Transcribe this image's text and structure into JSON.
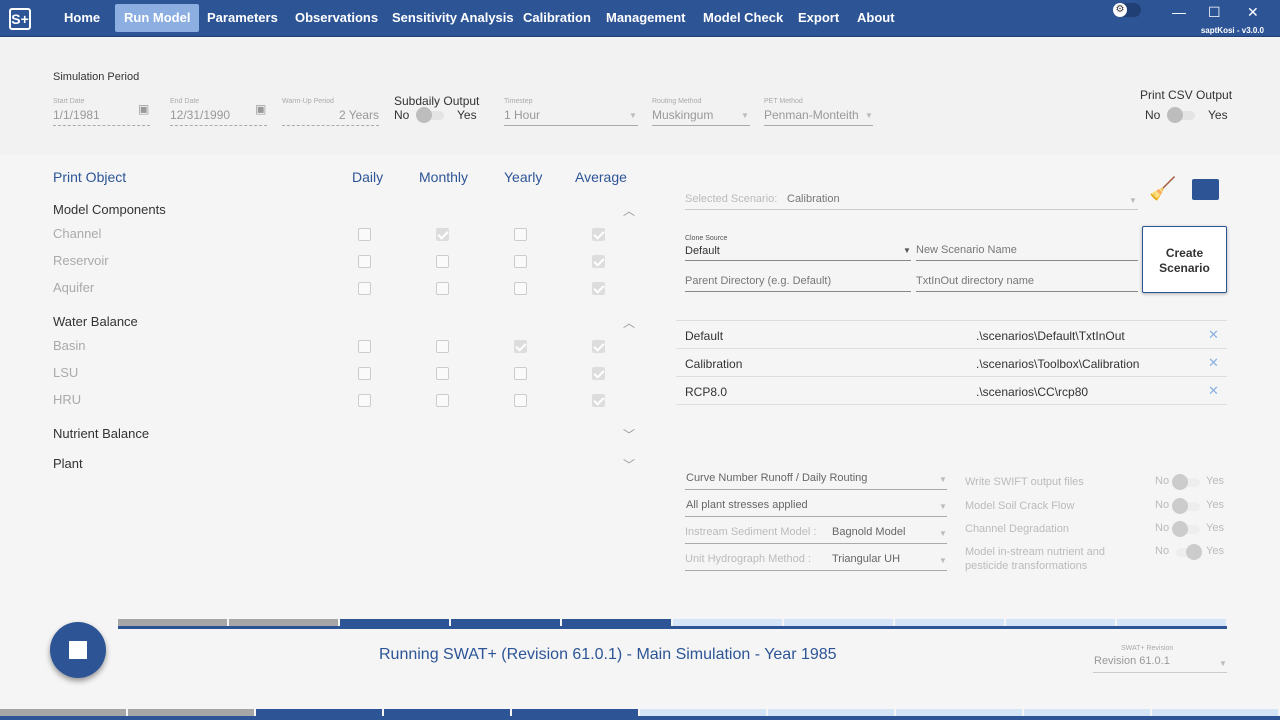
{
  "nav": {
    "logo": "S+",
    "items": [
      "Home",
      "Run Model",
      "Parameters",
      "Observations",
      "Sensitivity Analysis",
      "Calibration",
      "Management",
      "Model Check",
      "Export",
      "About"
    ],
    "active": "Run Model",
    "version": "saptKosi  -  v3.0.0"
  },
  "sim": {
    "title": "Simulation Period",
    "start_label": "Start Date",
    "start": "1/1/1981",
    "end_label": "End Date",
    "end": "12/31/1990",
    "warmup_label": "Warm-Up Period",
    "warmup": "2 Years",
    "subdaily_label": "Subdaily Output",
    "no": "No",
    "yes": "Yes",
    "timestep_label": "Timestep",
    "timestep": "1 Hour",
    "routing_label": "Routing Method",
    "routing": "Muskingum",
    "pet_label": "PET Method",
    "pet": "Penman-Monteith",
    "csv_label": "Print CSV Output",
    "subdaily_on": false,
    "csv_on": false
  },
  "print": {
    "header": "Print Object",
    "cols": [
      "Daily",
      "Monthly",
      "Yearly",
      "Average"
    ],
    "sections": [
      {
        "name": "Model Components",
        "expanded": true,
        "items": [
          {
            "name": "Channel",
            "checks": [
              false,
              true,
              false,
              true
            ]
          },
          {
            "name": "Reservoir",
            "checks": [
              false,
              false,
              false,
              true
            ]
          },
          {
            "name": "Aquifer",
            "checks": [
              false,
              false,
              false,
              true
            ]
          }
        ]
      },
      {
        "name": "Water Balance",
        "expanded": true,
        "items": [
          {
            "name": "Basin",
            "checks": [
              false,
              false,
              true,
              true
            ]
          },
          {
            "name": "LSU",
            "checks": [
              false,
              false,
              false,
              true
            ]
          },
          {
            "name": "HRU",
            "checks": [
              false,
              false,
              false,
              true
            ]
          }
        ]
      },
      {
        "name": "Nutrient Balance",
        "expanded": false
      },
      {
        "name": "Plant",
        "expanded": false
      }
    ]
  },
  "scenario": {
    "selected_label": "Selected Scenario:",
    "selected": "Calibration",
    "clone_label": "Clone Source",
    "clone": "Default",
    "new_name_placeholder": "New Scenario Name",
    "parent_placeholder": "Parent Directory (e.g. Default)",
    "txt_placeholder": "TxtInOut directory name",
    "create": "Create Scenario",
    "list": [
      {
        "name": "Default",
        "path": ".\\scenarios\\Default\\TxtInOut"
      },
      {
        "name": "Calibration",
        "path": ".\\scenarios\\Toolbox\\Calibration"
      },
      {
        "name": "RCP8.0",
        "path": ".\\scenarios\\CC\\rcp80"
      }
    ]
  },
  "options": {
    "runoff": "Curve Number Runoff / Daily Routing",
    "stress": "All plant stresses applied",
    "sed_label": "Instream Sediment Model  :",
    "sed": "Bagnold Model",
    "uh_label": "Unit Hydrograph Method   :",
    "uh": "Triangular UH",
    "toggles": [
      {
        "label": "Write SWIFT output files",
        "on": false
      },
      {
        "label": "Model Soil Crack Flow",
        "on": false
      },
      {
        "label": "Channel Degradation",
        "on": false
      },
      {
        "label": "Model in-stream nutrient and pesticide transformations",
        "on": true
      }
    ]
  },
  "status": {
    "text": "Running SWAT+ (Revision 61.0.1) - Main Simulation - Year 1985",
    "rev_label": "SWAT+ Revision",
    "rev": "Revision 61.0.1",
    "segments": [
      "done",
      "done",
      "active",
      "active",
      "active",
      "pending",
      "pending",
      "pending",
      "pending",
      "pending"
    ]
  },
  "colors": {
    "brand": "#2d5596",
    "done": "#a6a6a6",
    "active": "#2d5596",
    "pending": "#d6e4f7"
  }
}
